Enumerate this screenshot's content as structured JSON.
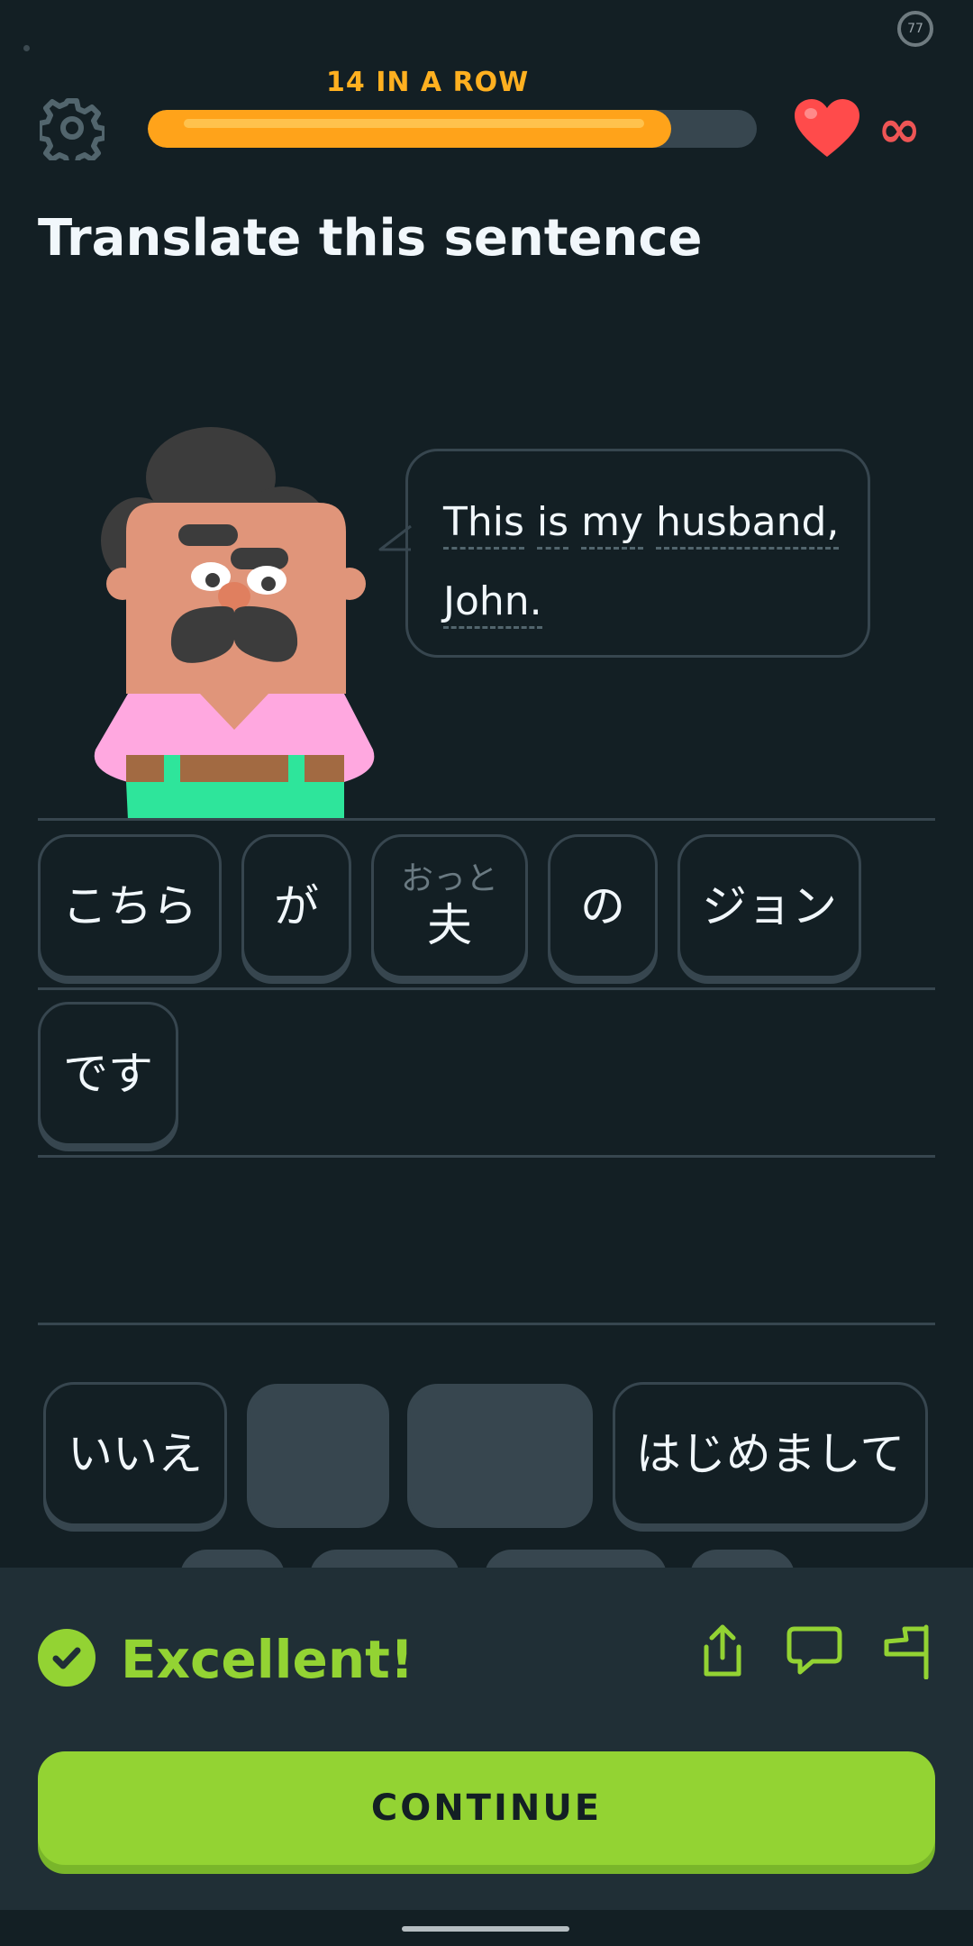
{
  "status": {
    "battery_level": "77"
  },
  "header": {
    "streak_label": "14 IN A ROW",
    "progress_fraction": 0.86,
    "lives": "∞",
    "accent_orange": "#ffa31a",
    "heart_color": "#ff4b4b"
  },
  "title": "Translate this sentence",
  "bubble": {
    "words": [
      "This",
      "is",
      "my",
      "husband,",
      "John."
    ]
  },
  "answer_tiles": [
    {
      "text": "こちら",
      "furigana": ""
    },
    {
      "text": "が",
      "furigana": ""
    },
    {
      "text": "夫",
      "furigana": "おっと"
    },
    {
      "text": "の",
      "furigana": ""
    },
    {
      "text": "ジョン",
      "furigana": ""
    },
    {
      "text": "です",
      "furigana": ""
    }
  ],
  "word_bank": [
    {
      "text": "いいえ",
      "used": false
    },
    {
      "text": "",
      "used": true
    },
    {
      "text": "",
      "used": true
    },
    {
      "text": "はじめまして",
      "used": false
    }
  ],
  "feedback": {
    "message": "Excellent!",
    "color": "#93d333",
    "actions": [
      "share-icon",
      "comment-icon",
      "report-flag-icon"
    ]
  },
  "continue_label": "CONTINUE"
}
